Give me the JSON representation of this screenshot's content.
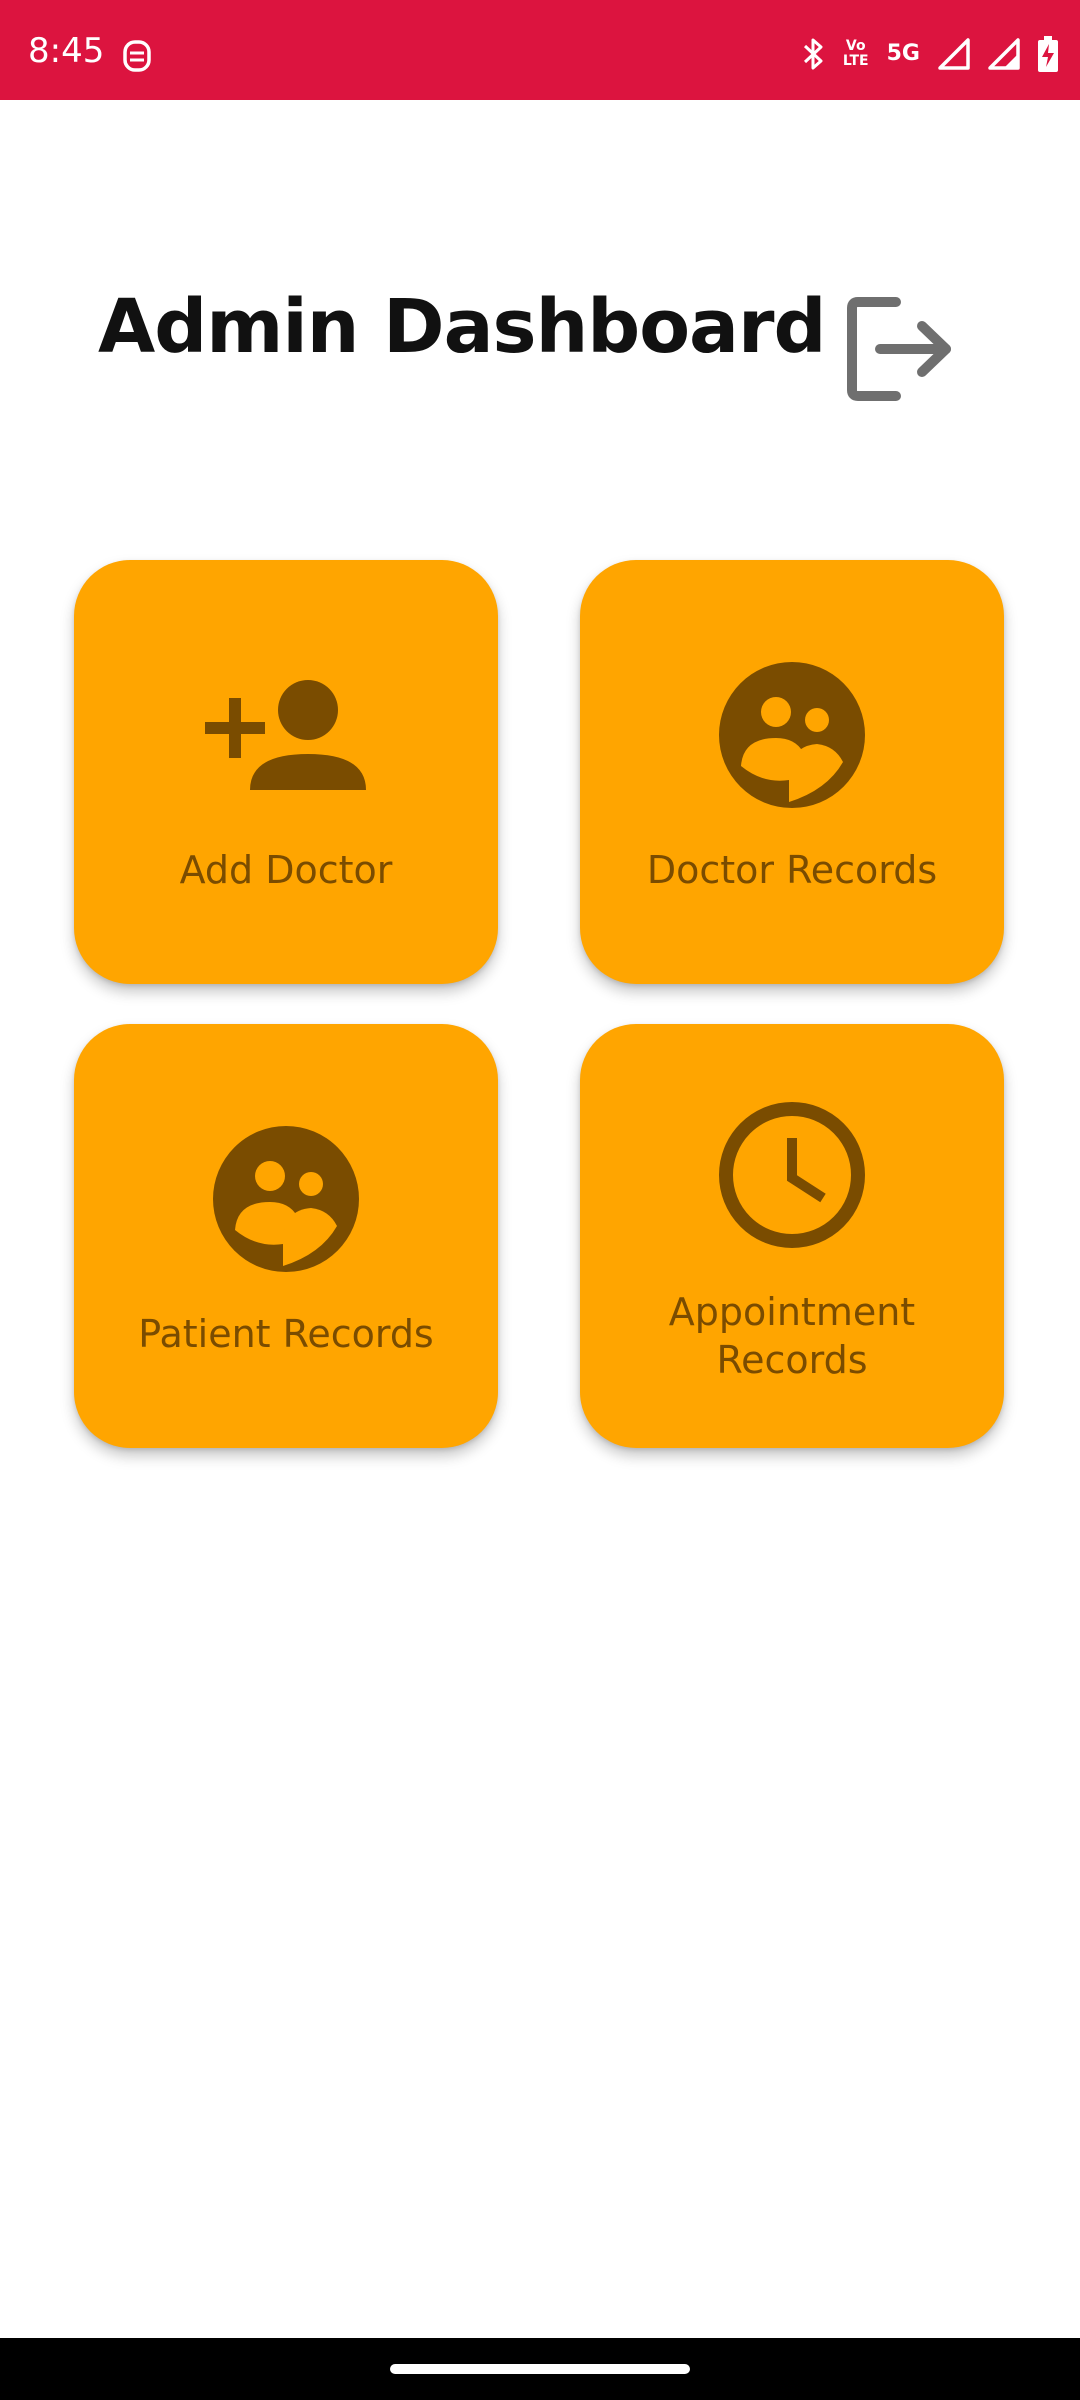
{
  "status_bar": {
    "time": "8:45",
    "network_badge_line1": "Vo",
    "network_badge_line2": "LTE",
    "network_type": "5G",
    "icons": [
      "app-notification-icon",
      "bluetooth-icon",
      "volte-icon",
      "signal-icon",
      "signal-icon",
      "battery-charging-icon"
    ]
  },
  "header": {
    "title": "Admin Dashboard",
    "logout_icon": "logout-icon"
  },
  "tiles": [
    {
      "label": "Add Doctor",
      "icon": "person-add-icon"
    },
    {
      "label": "Doctor Records",
      "icon": "people-face-icon"
    },
    {
      "label": "Patient Records",
      "icon": "people-face-icon"
    },
    {
      "label_line1": "Appointment",
      "label_line2": "Records",
      "icon": "clock-icon"
    }
  ],
  "colors": {
    "status_bar": "#DC143F",
    "tile_background": "#FFA500",
    "tile_foreground": "#7A4C00",
    "logout_icon": "#6F6F6F",
    "title_text": "#111111"
  }
}
